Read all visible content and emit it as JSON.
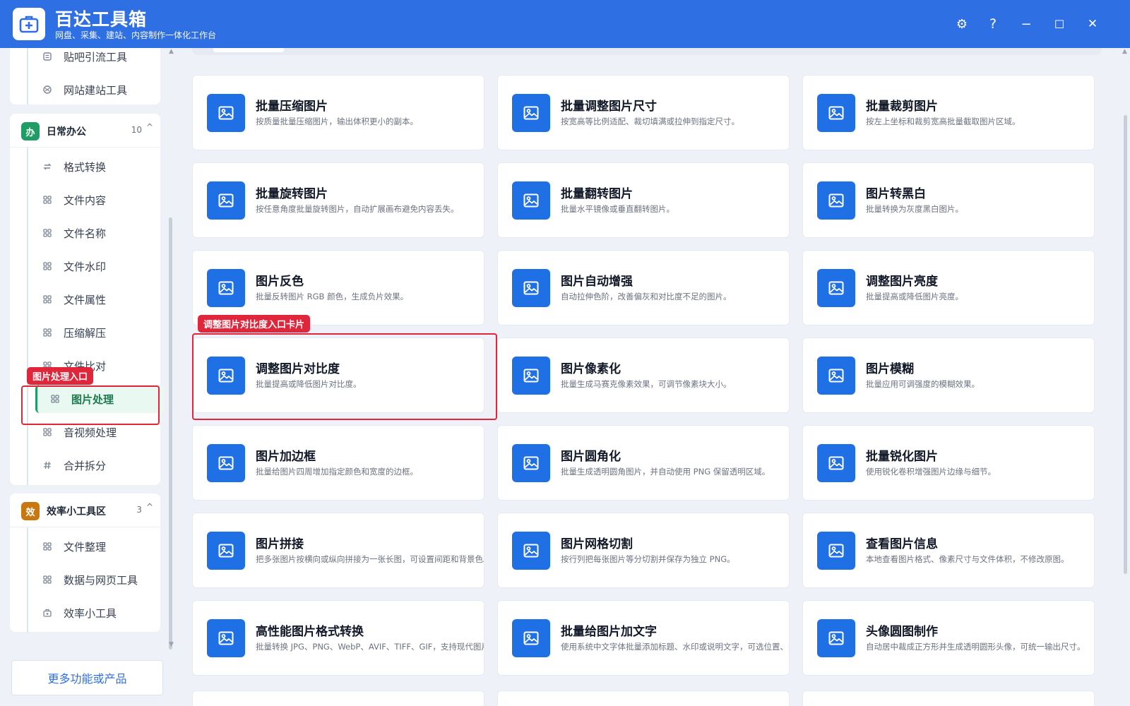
{
  "app": {
    "title": "百达工具箱",
    "subtitle": "网盘、采集、建站、内容制作一体化工作台",
    "accent_color": "#2f6fe4"
  },
  "window_controls": [
    {
      "name": "settings-icon",
      "glyph": "⚙"
    },
    {
      "name": "help-icon",
      "glyph": "?"
    },
    {
      "name": "minimize-icon",
      "glyph": "−"
    },
    {
      "name": "maximize-icon",
      "glyph": "☐"
    },
    {
      "name": "close-icon",
      "glyph": "✕"
    }
  ],
  "sidebar": {
    "top_items": [
      {
        "label": "贴吧引流工具",
        "icon": "list-icon"
      },
      {
        "label": "网站建站工具",
        "icon": "globe-icon"
      }
    ],
    "categories": [
      {
        "badge": "办",
        "badge_color": "#1e9e64",
        "label": "日常办公",
        "count": "10",
        "chevron": "^",
        "items": [
          {
            "label": "格式转换",
            "icon": "swap-icon"
          },
          {
            "label": "文件内容",
            "icon": "grid-icon"
          },
          {
            "label": "文件名称",
            "icon": "grid-icon"
          },
          {
            "label": "文件水印",
            "icon": "grid-icon"
          },
          {
            "label": "文件属性",
            "icon": "grid-icon"
          },
          {
            "label": "压缩解压",
            "icon": "grid-icon"
          },
          {
            "label": "文件比对",
            "icon": "grid-icon"
          },
          {
            "label": "图片处理",
            "icon": "grid-icon",
            "active": true
          },
          {
            "label": "音视频处理",
            "icon": "grid-icon"
          },
          {
            "label": "合并拆分",
            "icon": "hash-icon"
          }
        ]
      },
      {
        "badge": "效",
        "badge_color": "#c9770f",
        "label": "效率小工具区",
        "count": "3",
        "chevron": "^",
        "items": [
          {
            "label": "文件整理",
            "icon": "grid-icon"
          },
          {
            "label": "数据与网页工具",
            "icon": "grid-icon"
          },
          {
            "label": "效率小工具",
            "icon": "toolbox-icon"
          }
        ]
      }
    ],
    "more_button": "更多功能或产品",
    "annotation": "图片处理入口"
  },
  "main": {
    "annotation": "调整图片对比度入口卡片",
    "cards": [
      {
        "title": "批量压缩图片",
        "desc": "按质量批量压缩图片，输出体积更小的副本。"
      },
      {
        "title": "批量调整图片尺寸",
        "desc": "按宽高等比例适配、裁切填满或拉伸到指定尺寸。"
      },
      {
        "title": "批量裁剪图片",
        "desc": "按左上坐标和裁剪宽高批量截取图片区域。"
      },
      {
        "title": "批量旋转图片",
        "desc": "按任意角度批量旋转图片，自动扩展画布避免内容丢失。"
      },
      {
        "title": "批量翻转图片",
        "desc": "批量水平镜像或垂直翻转图片。"
      },
      {
        "title": "图片转黑白",
        "desc": "批量转换为灰度黑白图片。"
      },
      {
        "title": "图片反色",
        "desc": "批量反转图片 RGB 颜色，生成负片效果。"
      },
      {
        "title": "图片自动增强",
        "desc": "自动拉伸色阶，改善偏灰和对比度不足的图片。"
      },
      {
        "title": "调整图片亮度",
        "desc": "批量提高或降低图片亮度。"
      },
      {
        "title": "调整图片对比度",
        "desc": "批量提高或降低图片对比度。",
        "highlighted": true
      },
      {
        "title": "图片像素化",
        "desc": "批量生成马赛克像素效果，可调节像素块大小。"
      },
      {
        "title": "图片模糊",
        "desc": "批量应用可调强度的模糊效果。"
      },
      {
        "title": "图片加边框",
        "desc": "批量给图片四周增加指定颜色和宽度的边框。"
      },
      {
        "title": "图片圆角化",
        "desc": "批量生成透明圆角图片，并自动使用 PNG 保留透明区域。"
      },
      {
        "title": "批量锐化图片",
        "desc": "使用锐化卷积增强图片边缘与细节。"
      },
      {
        "title": "图片拼接",
        "desc": "把多张图片按横向或纵向拼接为一张长图，可设置间距和背景色。"
      },
      {
        "title": "图片网格切割",
        "desc": "按行列把每张图片等分切割并保存为独立 PNG。"
      },
      {
        "title": "查看图片信息",
        "desc": "本地查看图片格式、像素尺寸与文件体积，不修改原图。"
      },
      {
        "title": "高性能图片格式转换",
        "desc": "批量转换 JPG、PNG、WebP、AVIF、TIFF、GIF，支持现代图片"
      },
      {
        "title": "批量给图片加文字",
        "desc": "使用系统中文字体批量添加标题、水印或说明文字，可选位置、字"
      },
      {
        "title": "头像圆图制作",
        "desc": "自动居中裁成正方形并生成透明圆形头像，可统一输出尺寸。"
      }
    ]
  }
}
